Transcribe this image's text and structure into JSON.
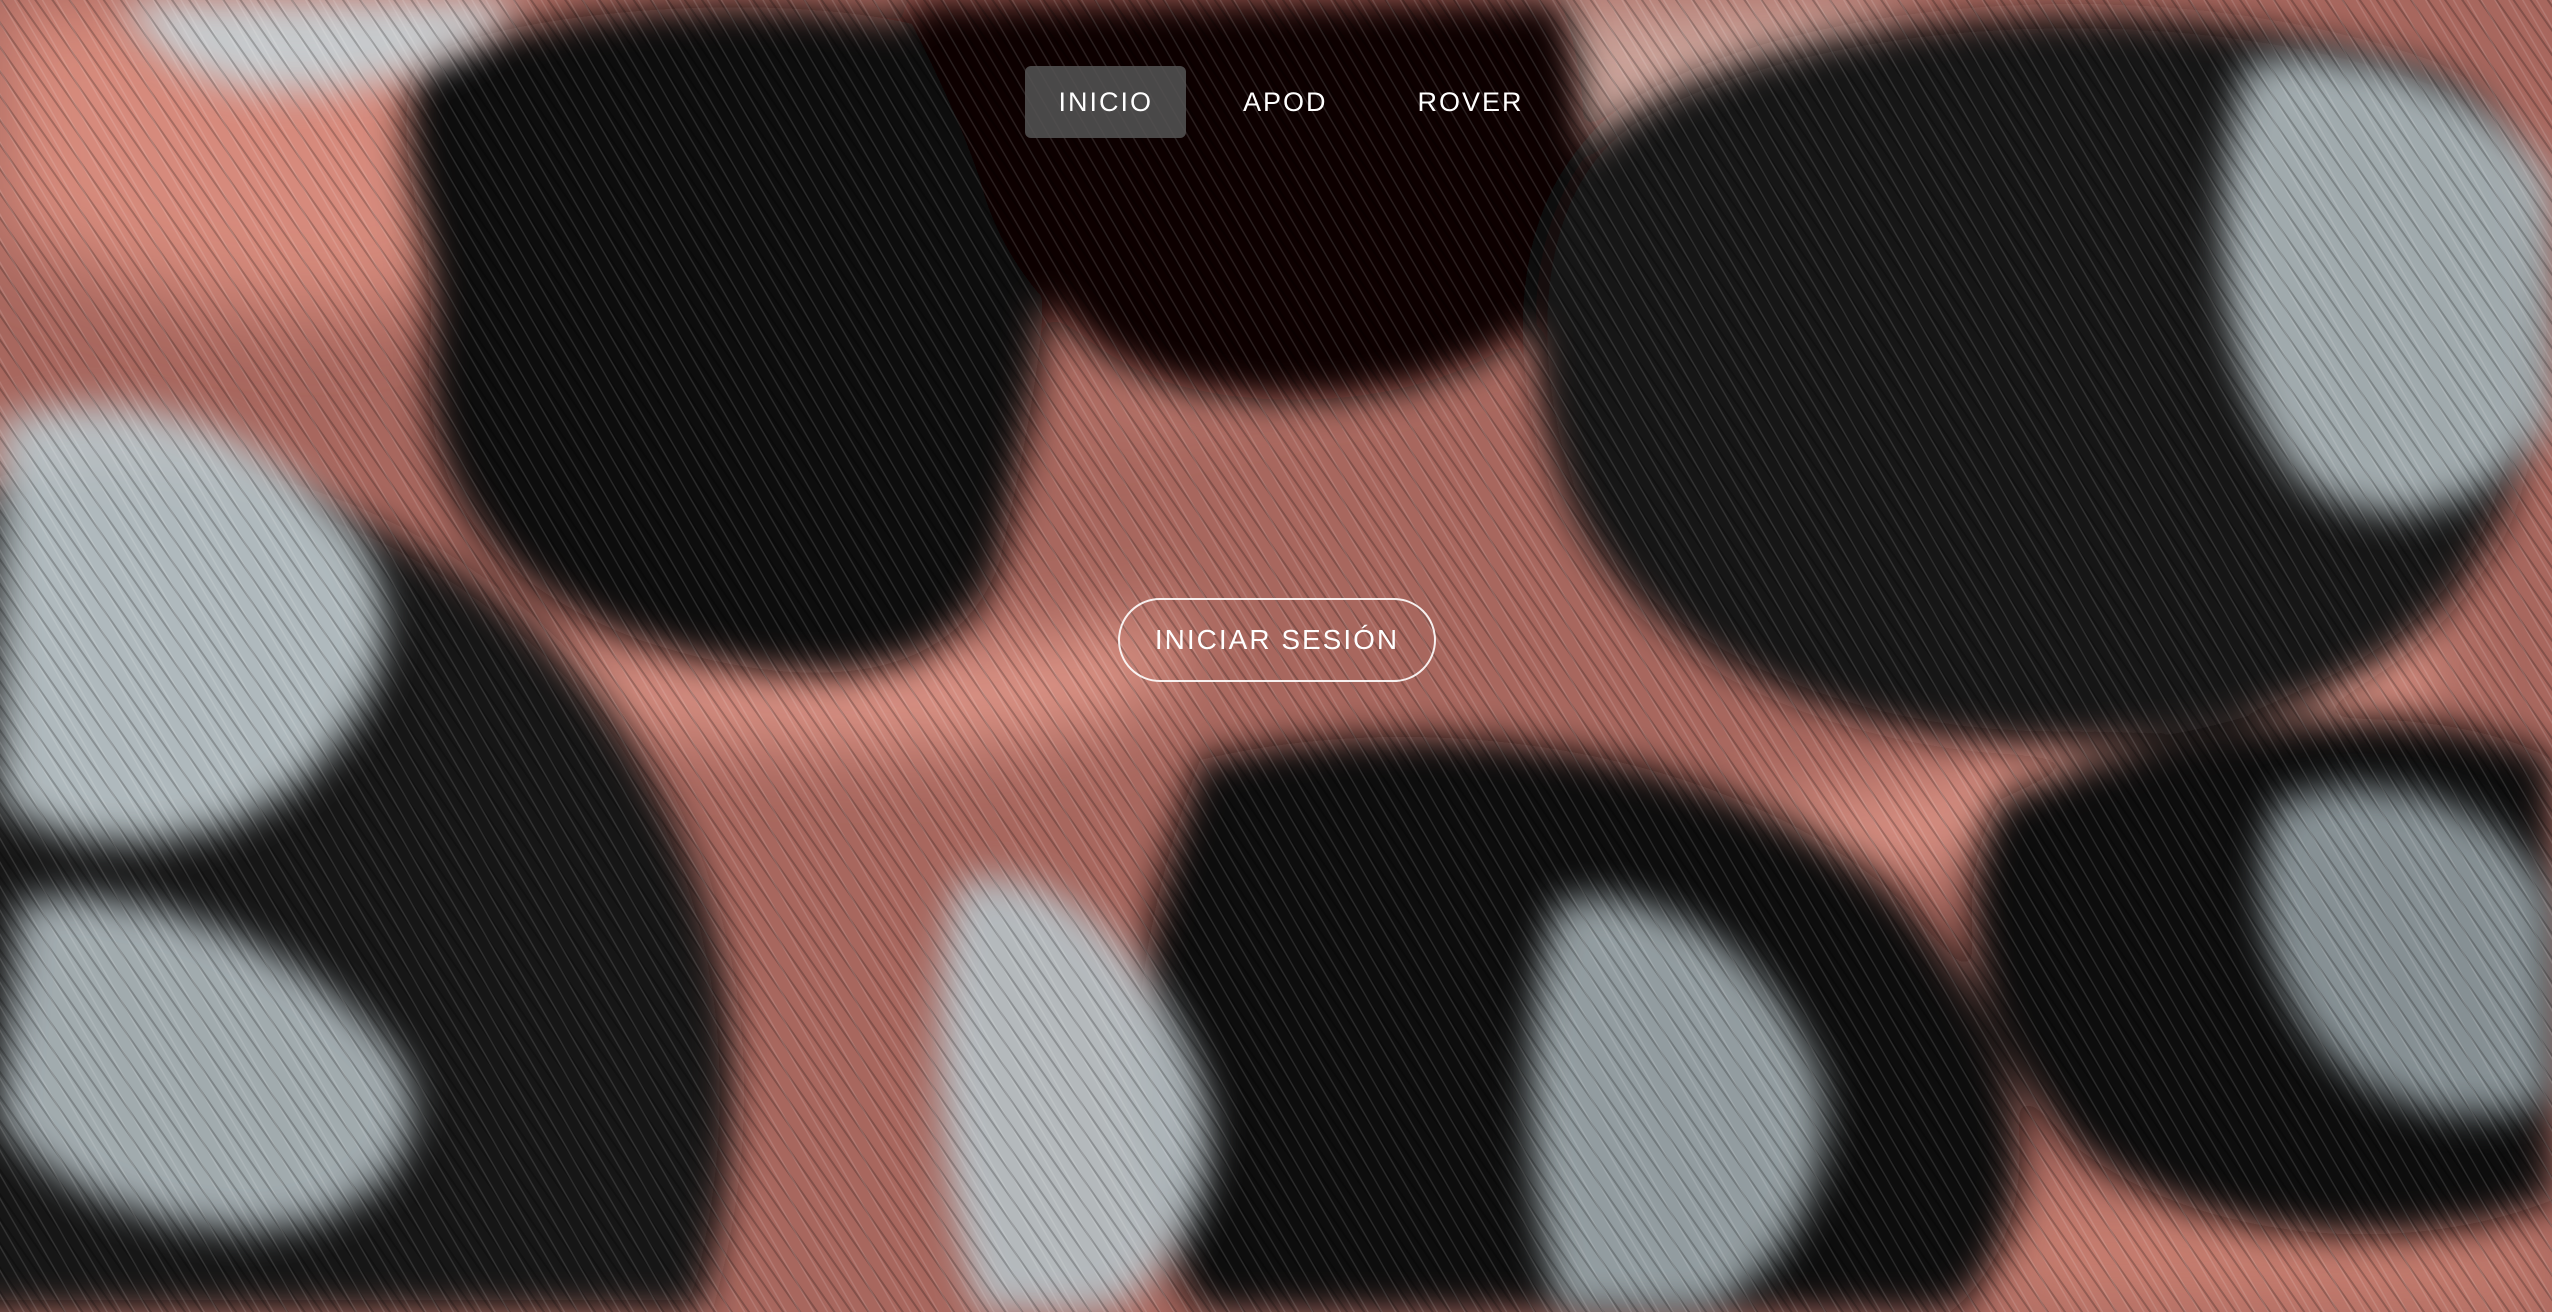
{
  "nav": {
    "items": [
      {
        "label": "INICIO",
        "active": true
      },
      {
        "label": "APOD",
        "active": false
      },
      {
        "label": "ROVER",
        "active": false
      }
    ]
  },
  "hero": {
    "login_label": "INICIAR SESIÓN",
    "background": "mars-sand-dunes-image"
  },
  "colors": {
    "dune_dark": "#0e0b0b",
    "dune_pink": "#d98a7c",
    "frost": "#c9d3d8",
    "nav_active_bg": "#555555",
    "text": "#ffffff"
  }
}
